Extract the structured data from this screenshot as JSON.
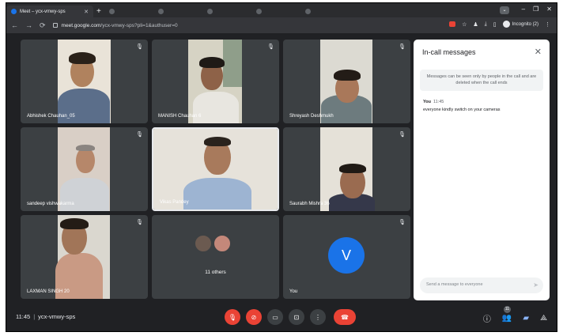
{
  "browser": {
    "active_tab_title": "Meet – ycx-vmwy-sps",
    "url_host": "meet.google.com",
    "url_path": "/ycx-vmwy-sps?pli=1&authuser=0",
    "incognito_label": "Incognito (2)"
  },
  "participants": [
    {
      "name": "Abhishek Chauhan_05"
    },
    {
      "name": "MANISH Chauhan 6"
    },
    {
      "name": "Shreyash Deshmukh"
    },
    {
      "name": "sandeep vishwakarma"
    },
    {
      "name": "Vikas Pandey"
    },
    {
      "name": "Saurabh Mishra 36"
    },
    {
      "name": "LAXMAN SINGH 20"
    },
    {
      "name": "11 others"
    },
    {
      "name": "You",
      "initial": "V"
    }
  ],
  "chat": {
    "title": "In-call messages",
    "notice": "Messages can be seen only by people in the call and are deleted when the call ends",
    "sender": "You",
    "time": "11:45",
    "message": "everyone kindly switch on your cameras",
    "input_placeholder": "Send a message to everyone"
  },
  "meeting": {
    "time": "11:45",
    "code": "ycx-vmwy-sps",
    "participant_count": "11"
  },
  "colors": {
    "background": "#202124",
    "tile": "#3c4043",
    "accent_blue": "#1a73e8",
    "danger_red": "#ea4335"
  }
}
